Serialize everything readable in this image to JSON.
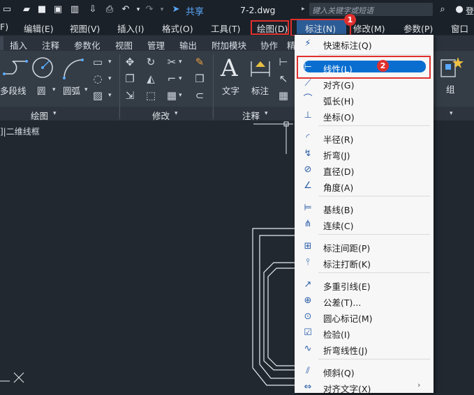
{
  "titlebar": {
    "share_label": "共享",
    "filename": "7-2.dwg",
    "search_placeholder": "键入关键字或短语",
    "user_label": "登"
  },
  "menubar": {
    "items": [
      "F)",
      "编辑(E)",
      "视图(V)",
      "插入(I)",
      "格式(O)",
      "工具(T)",
      "绘图(D)",
      "标注(N)",
      "修改(M)",
      "参数(P)",
      "窗口"
    ]
  },
  "ribbon_tabs": [
    "插入",
    "注释",
    "参数化",
    "视图",
    "管理",
    "输出",
    "附加模块",
    "协作",
    "精"
  ],
  "ribbon": {
    "draw_tools": [
      "多段线",
      "圆",
      "圆弧"
    ],
    "draw_panel": "绘图",
    "modify_panel": "修改",
    "annotation_tools": [
      "文字",
      "标注"
    ],
    "annotation_panel": "注释",
    "group_tool": "组"
  },
  "viewport": {
    "label": "]|二维线框"
  },
  "annotations": {
    "badge1": "1",
    "badge2": "2"
  },
  "dropdown": {
    "groups": [
      [
        {
          "label": "快速标注(Q)",
          "icon": "quick-dimension-icon"
        }
      ],
      [
        {
          "label": "线性(L)",
          "icon": "linear-dimension-icon"
        },
        {
          "label": "对齐(G)",
          "icon": "aligned-dimension-icon"
        },
        {
          "label": "弧长(H)",
          "icon": "arc-length-icon"
        },
        {
          "label": "坐标(O)",
          "icon": "ordinate-icon"
        }
      ],
      [
        {
          "label": "半径(R)",
          "icon": "radius-icon"
        },
        {
          "label": "折弯(J)",
          "icon": "jogged-icon"
        },
        {
          "label": "直径(D)",
          "icon": "diameter-icon"
        },
        {
          "label": "角度(A)",
          "icon": "angular-icon"
        }
      ],
      [
        {
          "label": "基线(B)",
          "icon": "baseline-icon"
        },
        {
          "label": "连续(C)",
          "icon": "continue-icon"
        }
      ],
      [
        {
          "label": "标注间距(P)",
          "icon": "dim-space-icon"
        },
        {
          "label": "标注打断(K)",
          "icon": "dim-break-icon"
        }
      ],
      [
        {
          "label": "多重引线(E)",
          "icon": "multileader-icon"
        },
        {
          "label": "公差(T)...",
          "icon": "tolerance-icon"
        },
        {
          "label": "圆心标记(M)",
          "icon": "center-mark-icon"
        },
        {
          "label": "检验(I)",
          "icon": "inspection-icon"
        },
        {
          "label": "折弯线性(J)",
          "icon": "jogged-linear-icon"
        }
      ],
      [
        {
          "label": "倾斜(Q)",
          "icon": "oblique-icon"
        },
        {
          "label": "对齐文字(X)",
          "icon": "align-text-icon"
        }
      ]
    ]
  }
}
